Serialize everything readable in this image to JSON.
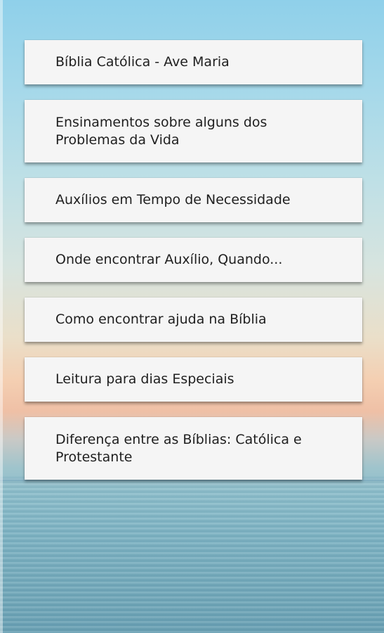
{
  "menu": {
    "items": [
      {
        "label": "Bíblia Católica - Ave Maria"
      },
      {
        "label": "Ensinamentos sobre alguns dos Problemas da Vida"
      },
      {
        "label": "Auxílios em Tempo de Necessidade"
      },
      {
        "label": "Onde encontrar Auxílio, Quando..."
      },
      {
        "label": "Como encontrar ajuda na Bíblia"
      },
      {
        "label": "Leitura para dias Especiais"
      },
      {
        "label": "Diferença entre as Bíblias: Católica e Protestante"
      }
    ]
  },
  "colors": {
    "card_background": "#f5f5f5",
    "text": "#1f1f1f",
    "sky_top": "#8fd0ea",
    "sunset": "#f4cfb2",
    "sea": "#74aabb"
  }
}
